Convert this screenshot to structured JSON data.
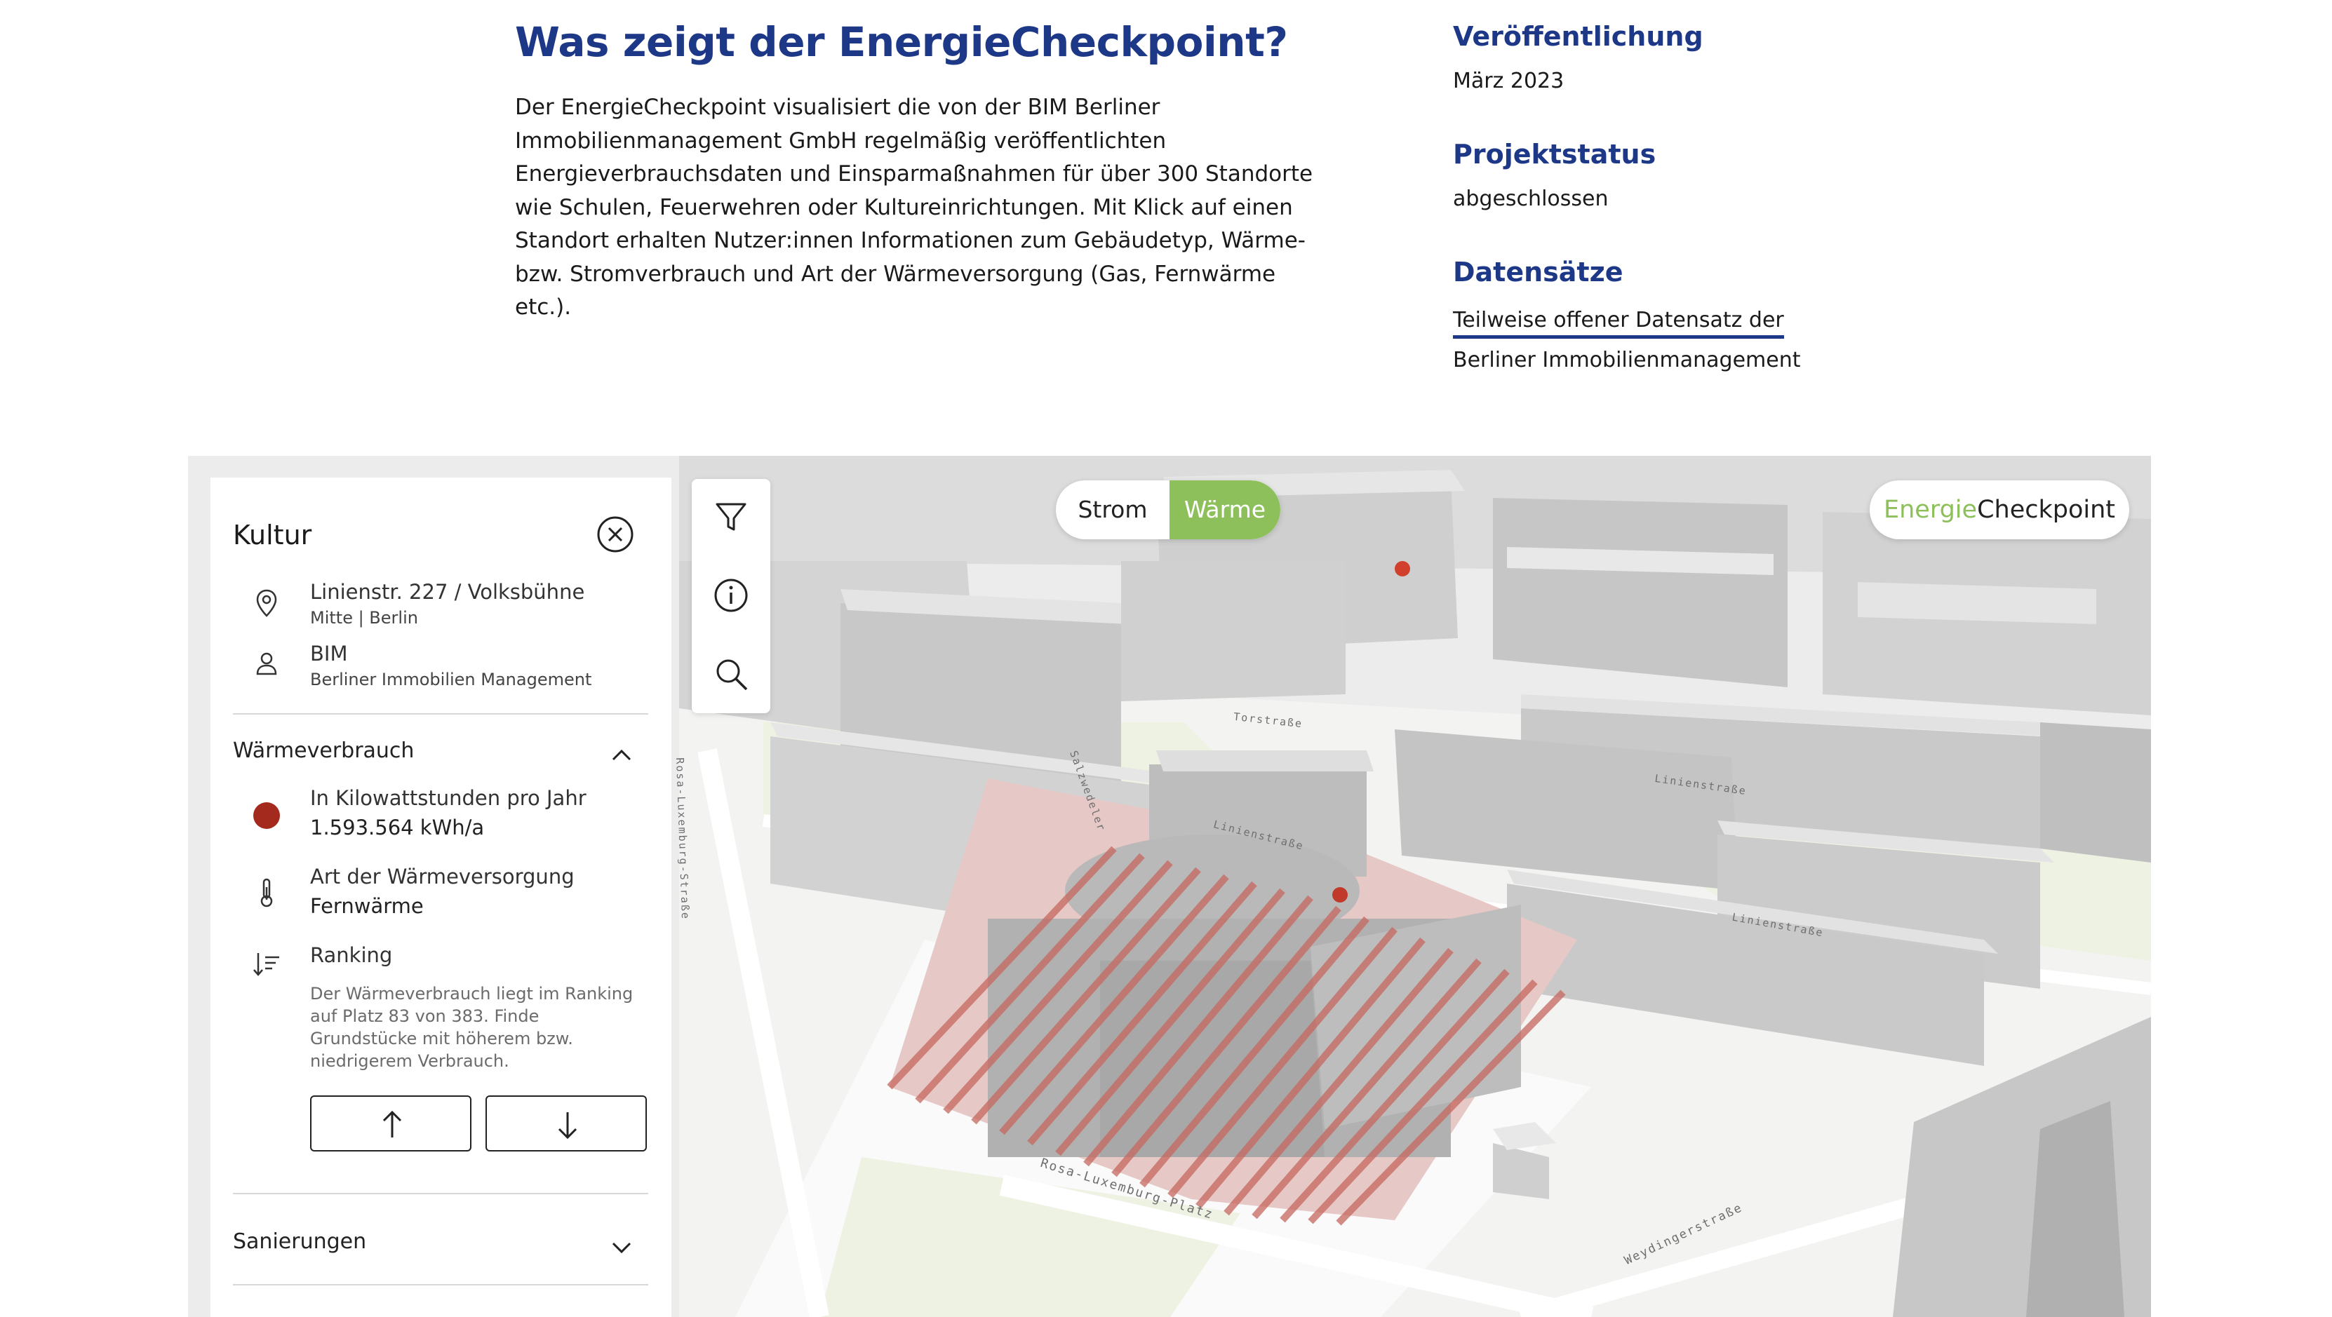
{
  "header": {
    "title": "Was zeigt der EnergieCheckpoint?",
    "intro": "Der EnergieCheckpoint visualisiert die von der BIM Berliner Immobilienmanagement GmbH regelmäßig veröffentlichten Energieverbrauchsdaten und Einsparmaßnahmen für über 300 Standorte wie Schulen, Feuerwehren oder Kultureinrichtungen. Mit Klick auf einen Standort erhalten Nutzer:innen Informationen zum Gebäudetyp, Wärme- bzw. Stromverbrauch und Art der Wärmeversorgung (Gas, Fernwärme etc.)."
  },
  "meta": {
    "publication_label": "Veröffentlichung",
    "publication_value": "März 2023",
    "status_label": "Projektstatus",
    "status_value": "abgeschlossen",
    "datasets_label": "Datensätze",
    "datasets_link_line1": "Teilweise offener Datensatz der",
    "datasets_link_line2": "Berliner Immobilienmanagement"
  },
  "map": {
    "toggle": {
      "option1": "Strom",
      "option2": "Wärme",
      "selected": "Wärme"
    },
    "brand": {
      "part1": "Energie",
      "part2": "Checkpoint"
    },
    "streets": [
      "Rosa-Luxemburg-Straße",
      "Rosa-Luxemburg-Platz",
      "Linienstraße",
      "Weydingerstraße",
      "Torstraße",
      "Salzwedeler",
      "Linienstraße",
      "Linienstraße"
    ],
    "tools": [
      "filter-icon",
      "info-icon",
      "search-icon"
    ]
  },
  "panel": {
    "title": "Kultur",
    "address_main": "Linienstr. 227 / Volksbühne",
    "address_sub": "Mitte | Berlin",
    "owner_main": "BIM",
    "owner_sub": "Berliner Immobilien Management",
    "heat_section": "Wärmeverbrauch",
    "consumption_label": "In Kilowattstunden pro Jahr",
    "consumption_value": "1.593.564 kWh/a",
    "supply_label": "Art der Wärmeversorgung",
    "supply_value": "Fernwärme",
    "ranking_label": "Ranking",
    "ranking_text": "Der Wärmeverbrauch liegt im Ranking auf Platz 83 von 383. Finde Grundstücke mit höherem bzw. niedrigerem Verbrauch.",
    "renovation_section": "Sanierungen",
    "colors": {
      "consumption_dot": "#a52a1e",
      "accent": "#1e3888",
      "green": "#8dc05b"
    }
  }
}
